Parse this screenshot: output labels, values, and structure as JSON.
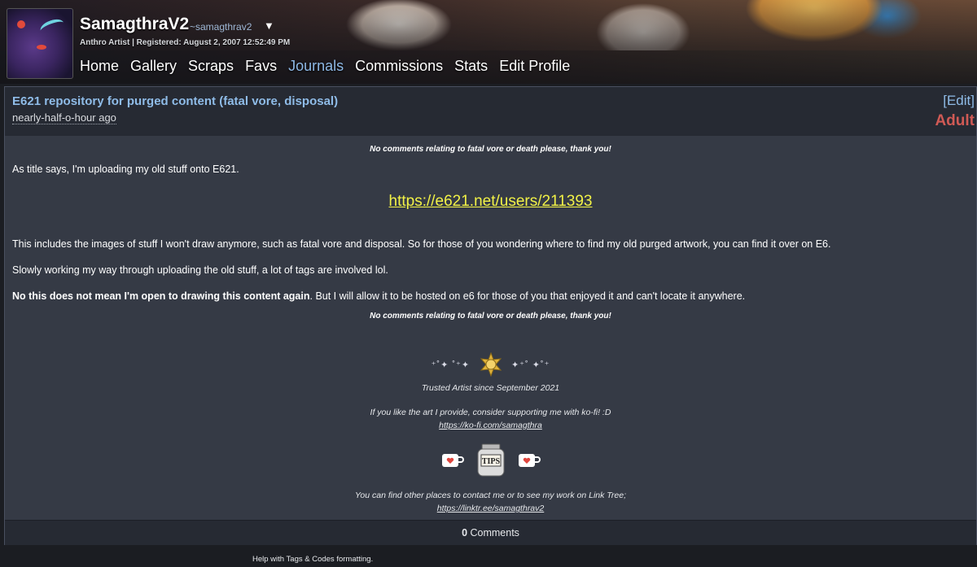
{
  "profile": {
    "username": "SamagthraV2",
    "handle": "~samagthrav2",
    "caret": "▼",
    "subline": "Anthro Artist | Registered: August 2, 2007 12:52:49 PM"
  },
  "nav": {
    "items": [
      {
        "label": "Home"
      },
      {
        "label": "Gallery"
      },
      {
        "label": "Scraps"
      },
      {
        "label": "Favs"
      },
      {
        "label": "Journals",
        "active": true
      },
      {
        "label": "Commissions"
      },
      {
        "label": "Stats"
      },
      {
        "label": "Edit Profile"
      }
    ]
  },
  "journal": {
    "title": "E621 repository for purged content (fatal vore, disposal)",
    "time": "nearly-half-o-hour ago",
    "edit_label": "[Edit]",
    "rating": "Adult",
    "note_top": "No comments relating to fatal vore or death please, thank you!",
    "p1": "As title says, I'm uploading my old stuff onto E621.",
    "link": "https://e621.net/users/211393",
    "p2": "This includes the images of stuff I won't draw anymore, such as fatal vore and disposal. So for those of you wondering where to find my old purged artwork, you can find it over on E6.",
    "p3": "Slowly working my way through uploading the old stuff, a lot of tags are involved lol.",
    "p4_bold": "No this does not mean I'm open to drawing this content again",
    "p4_rest": ". But I will allow it to be hosted on e6 for those of you that enjoyed it and can't locate it anywhere.",
    "note_bottom": "No comments relating to fatal vore or death please, thank you!"
  },
  "signature": {
    "trusted": "Trusted Artist since September 2021",
    "kofi_text": "If you like the art I provide, consider supporting me with ko-fi! :D",
    "kofi_link": "https://ko-fi.com/samagthra",
    "jar_label": "TIPS",
    "linktree_text": "You can find other places to contact me or to see my work on Link Tree;",
    "linktree_link": "https://linktr.ee/samagthrav2"
  },
  "comments": {
    "count": "0",
    "label": "Comments"
  },
  "help_text": "Help with Tags & Codes formatting.",
  "colors": {
    "accent_link": "#8fbce8",
    "rating_adult": "#d05a55",
    "highlight_link": "#f2f246"
  },
  "icons": [
    "avatar",
    "medal-icon",
    "sparkle-icon",
    "kofi-cup-icon",
    "tip-jar-icon"
  ]
}
